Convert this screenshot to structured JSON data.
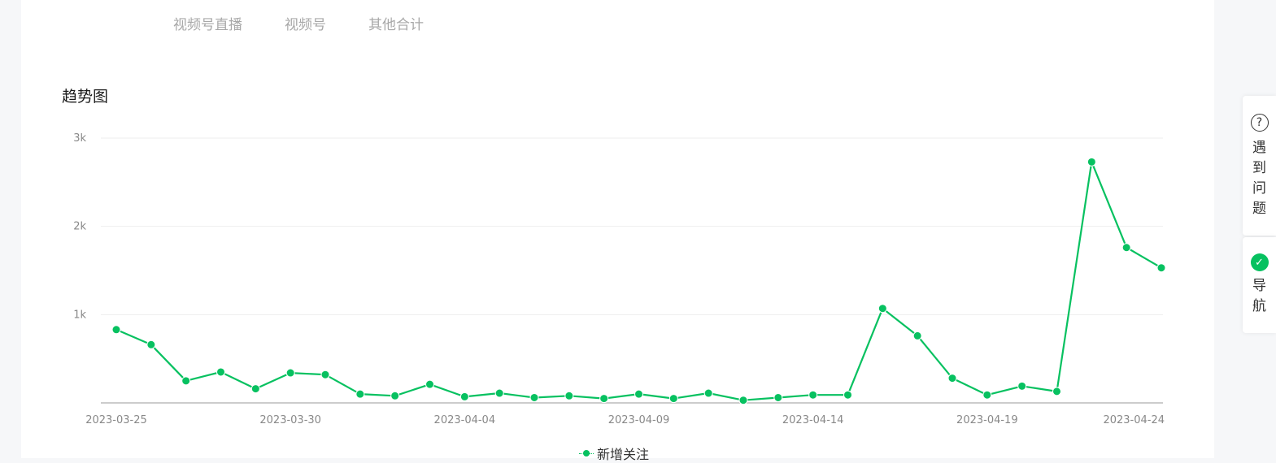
{
  "tabs": [
    {
      "label": "视频号直播"
    },
    {
      "label": "视频号"
    },
    {
      "label": "其他合计"
    }
  ],
  "section_title": "趋势图",
  "side_panel": {
    "help_label": "遇到问题",
    "nav_label": "导航"
  },
  "colors": {
    "series": "#07c160",
    "grid": "#eeeeee",
    "axis": "#cccccc",
    "tick": "#888888"
  },
  "chart_data": {
    "type": "line",
    "title": "趋势图",
    "xlabel": "",
    "ylabel": "",
    "ylim": [
      0,
      3000
    ],
    "yticks": [
      {
        "value": 1000,
        "label": "1k"
      },
      {
        "value": 2000,
        "label": "2k"
      },
      {
        "value": 3000,
        "label": "3k"
      }
    ],
    "xtick_labels": [
      "2023-03-25",
      "2023-03-30",
      "2023-04-04",
      "2023-04-09",
      "2023-04-14",
      "2023-04-19",
      "2023-04-24"
    ],
    "x": [
      "2023-03-25",
      "2023-03-26",
      "2023-03-27",
      "2023-03-28",
      "2023-03-29",
      "2023-03-30",
      "2023-03-31",
      "2023-04-01",
      "2023-04-02",
      "2023-04-03",
      "2023-04-04",
      "2023-04-05",
      "2023-04-06",
      "2023-04-07",
      "2023-04-08",
      "2023-04-09",
      "2023-04-10",
      "2023-04-11",
      "2023-04-12",
      "2023-04-13",
      "2023-04-14",
      "2023-04-15",
      "2023-04-16",
      "2023-04-17",
      "2023-04-18",
      "2023-04-19",
      "2023-04-20",
      "2023-04-21",
      "2023-04-22",
      "2023-04-23",
      "2023-04-24"
    ],
    "grid": true,
    "legend": "bottom-center",
    "series": [
      {
        "name": "新增关注",
        "values": [
          830,
          660,
          250,
          350,
          160,
          340,
          320,
          100,
          80,
          210,
          70,
          110,
          60,
          80,
          50,
          100,
          50,
          110,
          30,
          60,
          90,
          90,
          1070,
          760,
          280,
          90,
          190,
          130,
          2730,
          1760,
          1530
        ]
      }
    ]
  }
}
